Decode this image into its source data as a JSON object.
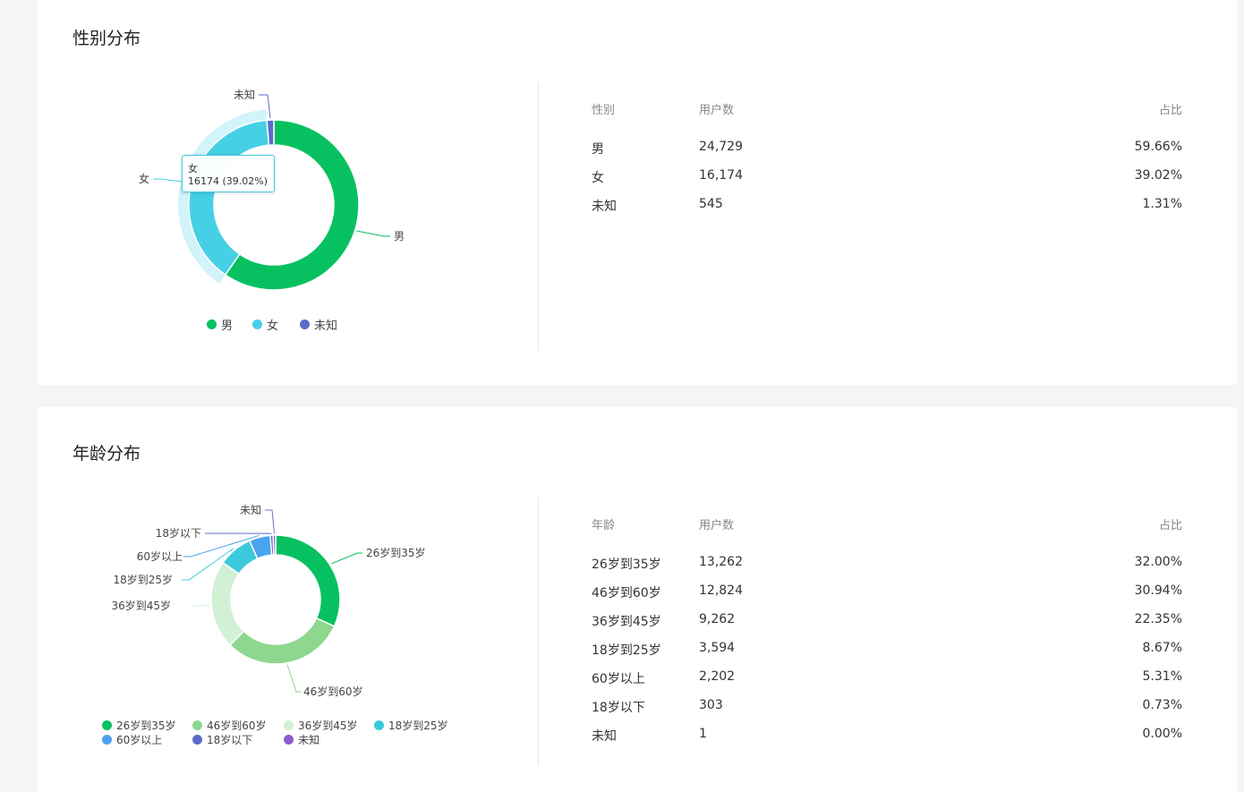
{
  "gender": {
    "title": "性别分布",
    "table": {
      "headers": [
        "性别",
        "用户数",
        "占比"
      ],
      "rows": [
        {
          "label": "男",
          "count": "24,729",
          "pct": "59.66%"
        },
        {
          "label": "女",
          "count": "16,174",
          "pct": "39.02%"
        },
        {
          "label": "未知",
          "count": "545",
          "pct": "1.31%"
        }
      ]
    },
    "tooltip": {
      "name": "女",
      "value": "16174 (39.02%)"
    }
  },
  "age": {
    "title": "年龄分布",
    "table": {
      "headers": [
        "年龄",
        "用户数",
        "占比"
      ],
      "rows": [
        {
          "label": "26岁到35岁",
          "count": "13,262",
          "pct": "32.00%"
        },
        {
          "label": "46岁到60岁",
          "count": "12,824",
          "pct": "30.94%"
        },
        {
          "label": "36岁到45岁",
          "count": "9,262",
          "pct": "22.35%"
        },
        {
          "label": "18岁到25岁",
          "count": "3,594",
          "pct": "8.67%"
        },
        {
          "label": "60岁以上",
          "count": "2,202",
          "pct": "5.31%"
        },
        {
          "label": "18岁以下",
          "count": "303",
          "pct": "0.73%"
        },
        {
          "label": "未知",
          "count": "1",
          "pct": "0.00%"
        }
      ]
    }
  },
  "chart_data": [
    {
      "type": "pie",
      "donut": true,
      "title": "性别分布",
      "categories": [
        "男",
        "女",
        "未知"
      ],
      "values": [
        24729,
        16174,
        545
      ],
      "colors": [
        "#07c160",
        "#46d0e6",
        "#5b6bc9"
      ],
      "legend": "bottom",
      "highlighted": "女"
    },
    {
      "type": "pie",
      "donut": true,
      "title": "年龄分布",
      "categories": [
        "26岁到35岁",
        "46岁到60岁",
        "36岁到45岁",
        "18岁到25岁",
        "60岁以上",
        "18岁以下",
        "未知"
      ],
      "values": [
        13262,
        12824,
        9262,
        3594,
        2202,
        303,
        1
      ],
      "colors": [
        "#07c160",
        "#8ed78f",
        "#d2f0d4",
        "#3dc9dd",
        "#4aa3ee",
        "#5b6bc9",
        "#8a5dd0"
      ],
      "legend": "bottom"
    }
  ]
}
